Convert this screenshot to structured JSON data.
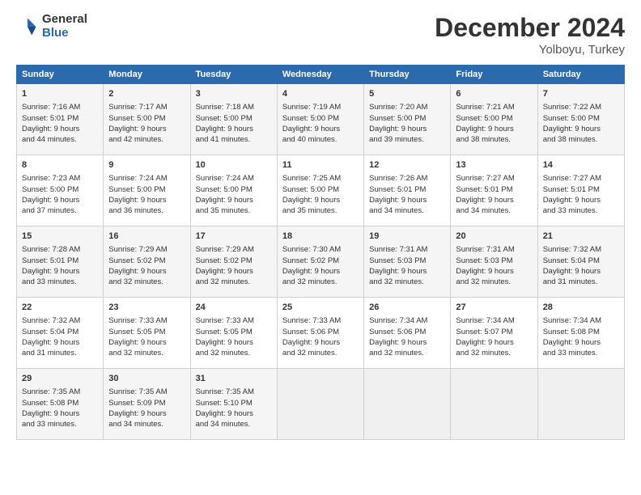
{
  "logo": {
    "general": "General",
    "blue": "Blue"
  },
  "header": {
    "month": "December 2024",
    "location": "Yolboyu, Turkey"
  },
  "weekdays": [
    "Sunday",
    "Monday",
    "Tuesday",
    "Wednesday",
    "Thursday",
    "Friday",
    "Saturday"
  ],
  "weeks": [
    [
      {
        "day": "1",
        "lines": [
          "Sunrise: 7:16 AM",
          "Sunset: 5:01 PM",
          "Daylight: 9 hours",
          "and 44 minutes."
        ]
      },
      {
        "day": "2",
        "lines": [
          "Sunrise: 7:17 AM",
          "Sunset: 5:00 PM",
          "Daylight: 9 hours",
          "and 42 minutes."
        ]
      },
      {
        "day": "3",
        "lines": [
          "Sunrise: 7:18 AM",
          "Sunset: 5:00 PM",
          "Daylight: 9 hours",
          "and 41 minutes."
        ]
      },
      {
        "day": "4",
        "lines": [
          "Sunrise: 7:19 AM",
          "Sunset: 5:00 PM",
          "Daylight: 9 hours",
          "and 40 minutes."
        ]
      },
      {
        "day": "5",
        "lines": [
          "Sunrise: 7:20 AM",
          "Sunset: 5:00 PM",
          "Daylight: 9 hours",
          "and 39 minutes."
        ]
      },
      {
        "day": "6",
        "lines": [
          "Sunrise: 7:21 AM",
          "Sunset: 5:00 PM",
          "Daylight: 9 hours",
          "and 38 minutes."
        ]
      },
      {
        "day": "7",
        "lines": [
          "Sunrise: 7:22 AM",
          "Sunset: 5:00 PM",
          "Daylight: 9 hours",
          "and 38 minutes."
        ]
      }
    ],
    [
      {
        "day": "8",
        "lines": [
          "Sunrise: 7:23 AM",
          "Sunset: 5:00 PM",
          "Daylight: 9 hours",
          "and 37 minutes."
        ]
      },
      {
        "day": "9",
        "lines": [
          "Sunrise: 7:24 AM",
          "Sunset: 5:00 PM",
          "Daylight: 9 hours",
          "and 36 minutes."
        ]
      },
      {
        "day": "10",
        "lines": [
          "Sunrise: 7:24 AM",
          "Sunset: 5:00 PM",
          "Daylight: 9 hours",
          "and 35 minutes."
        ]
      },
      {
        "day": "11",
        "lines": [
          "Sunrise: 7:25 AM",
          "Sunset: 5:00 PM",
          "Daylight: 9 hours",
          "and 35 minutes."
        ]
      },
      {
        "day": "12",
        "lines": [
          "Sunrise: 7:26 AM",
          "Sunset: 5:01 PM",
          "Daylight: 9 hours",
          "and 34 minutes."
        ]
      },
      {
        "day": "13",
        "lines": [
          "Sunrise: 7:27 AM",
          "Sunset: 5:01 PM",
          "Daylight: 9 hours",
          "and 34 minutes."
        ]
      },
      {
        "day": "14",
        "lines": [
          "Sunrise: 7:27 AM",
          "Sunset: 5:01 PM",
          "Daylight: 9 hours",
          "and 33 minutes."
        ]
      }
    ],
    [
      {
        "day": "15",
        "lines": [
          "Sunrise: 7:28 AM",
          "Sunset: 5:01 PM",
          "Daylight: 9 hours",
          "and 33 minutes."
        ]
      },
      {
        "day": "16",
        "lines": [
          "Sunrise: 7:29 AM",
          "Sunset: 5:02 PM",
          "Daylight: 9 hours",
          "and 32 minutes."
        ]
      },
      {
        "day": "17",
        "lines": [
          "Sunrise: 7:29 AM",
          "Sunset: 5:02 PM",
          "Daylight: 9 hours",
          "and 32 minutes."
        ]
      },
      {
        "day": "18",
        "lines": [
          "Sunrise: 7:30 AM",
          "Sunset: 5:02 PM",
          "Daylight: 9 hours",
          "and 32 minutes."
        ]
      },
      {
        "day": "19",
        "lines": [
          "Sunrise: 7:31 AM",
          "Sunset: 5:03 PM",
          "Daylight: 9 hours",
          "and 32 minutes."
        ]
      },
      {
        "day": "20",
        "lines": [
          "Sunrise: 7:31 AM",
          "Sunset: 5:03 PM",
          "Daylight: 9 hours",
          "and 32 minutes."
        ]
      },
      {
        "day": "21",
        "lines": [
          "Sunrise: 7:32 AM",
          "Sunset: 5:04 PM",
          "Daylight: 9 hours",
          "and 31 minutes."
        ]
      }
    ],
    [
      {
        "day": "22",
        "lines": [
          "Sunrise: 7:32 AM",
          "Sunset: 5:04 PM",
          "Daylight: 9 hours",
          "and 31 minutes."
        ]
      },
      {
        "day": "23",
        "lines": [
          "Sunrise: 7:33 AM",
          "Sunset: 5:05 PM",
          "Daylight: 9 hours",
          "and 32 minutes."
        ]
      },
      {
        "day": "24",
        "lines": [
          "Sunrise: 7:33 AM",
          "Sunset: 5:05 PM",
          "Daylight: 9 hours",
          "and 32 minutes."
        ]
      },
      {
        "day": "25",
        "lines": [
          "Sunrise: 7:33 AM",
          "Sunset: 5:06 PM",
          "Daylight: 9 hours",
          "and 32 minutes."
        ]
      },
      {
        "day": "26",
        "lines": [
          "Sunrise: 7:34 AM",
          "Sunset: 5:06 PM",
          "Daylight: 9 hours",
          "and 32 minutes."
        ]
      },
      {
        "day": "27",
        "lines": [
          "Sunrise: 7:34 AM",
          "Sunset: 5:07 PM",
          "Daylight: 9 hours",
          "and 32 minutes."
        ]
      },
      {
        "day": "28",
        "lines": [
          "Sunrise: 7:34 AM",
          "Sunset: 5:08 PM",
          "Daylight: 9 hours",
          "and 33 minutes."
        ]
      }
    ],
    [
      {
        "day": "29",
        "lines": [
          "Sunrise: 7:35 AM",
          "Sunset: 5:08 PM",
          "Daylight: 9 hours",
          "and 33 minutes."
        ]
      },
      {
        "day": "30",
        "lines": [
          "Sunrise: 7:35 AM",
          "Sunset: 5:09 PM",
          "Daylight: 9 hours",
          "and 34 minutes."
        ]
      },
      {
        "day": "31",
        "lines": [
          "Sunrise: 7:35 AM",
          "Sunset: 5:10 PM",
          "Daylight: 9 hours",
          "and 34 minutes."
        ]
      },
      {
        "day": "",
        "lines": []
      },
      {
        "day": "",
        "lines": []
      },
      {
        "day": "",
        "lines": []
      },
      {
        "day": "",
        "lines": []
      }
    ]
  ]
}
